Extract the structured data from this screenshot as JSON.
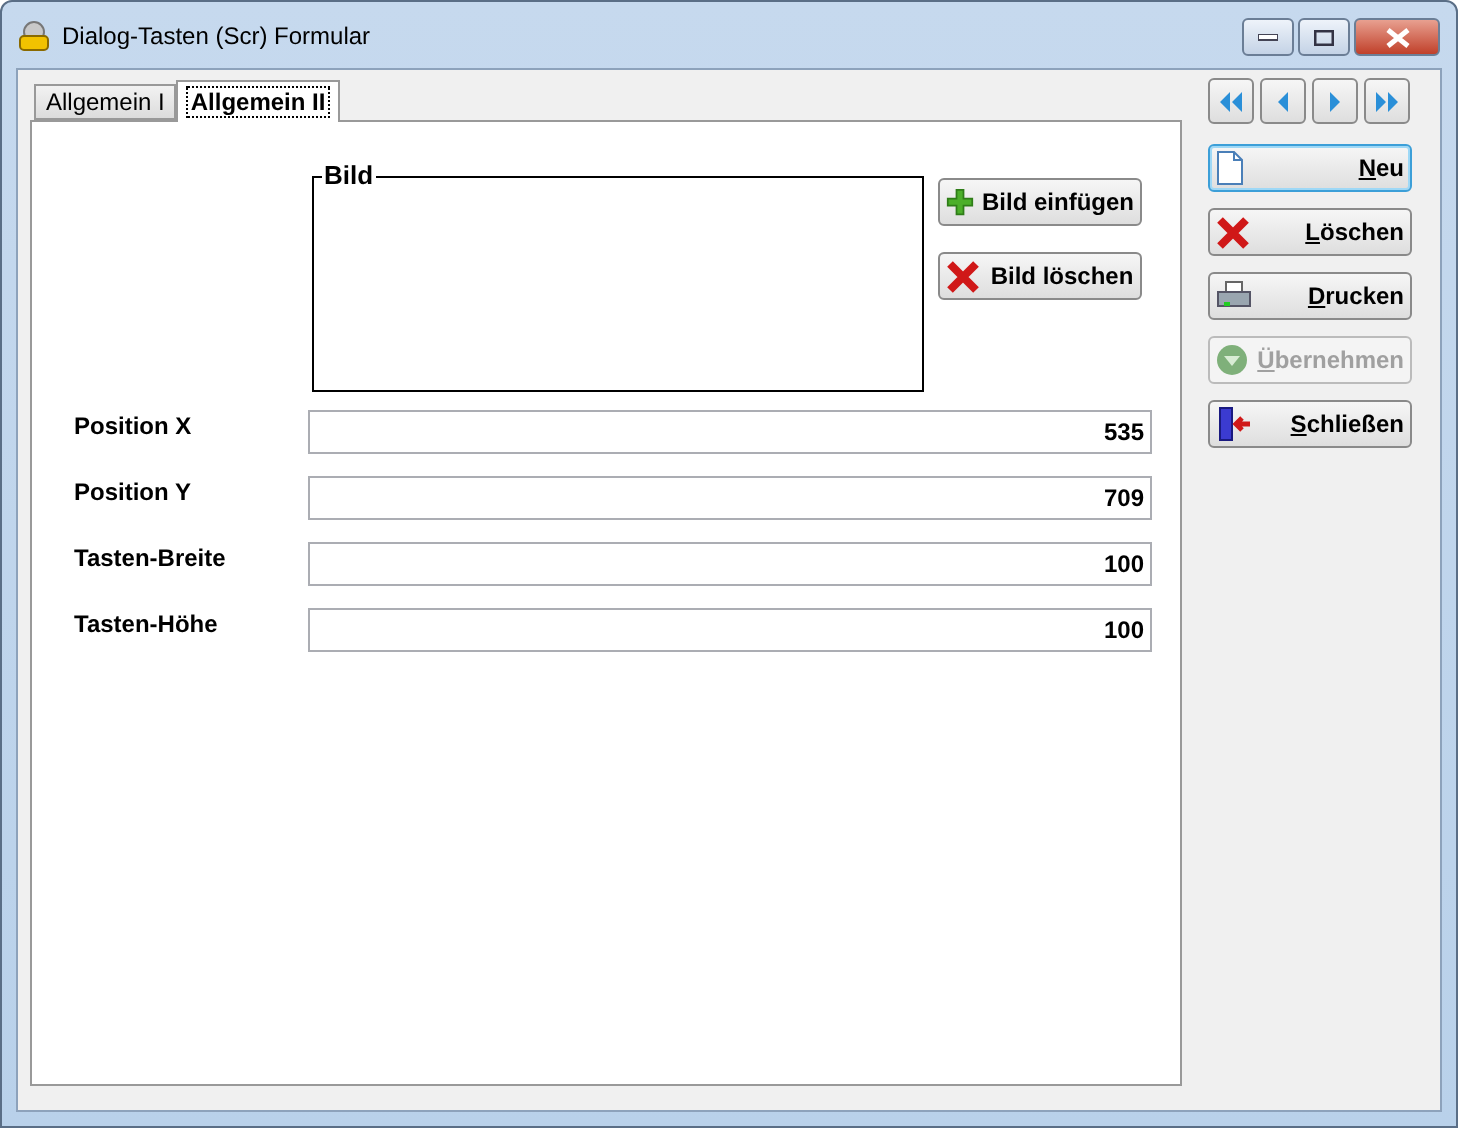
{
  "window": {
    "title": "Dialog-Tasten (Scr) Formular"
  },
  "tabs": [
    {
      "label": "Allgemein I",
      "selected": false
    },
    {
      "label": "Allgemein II",
      "selected": true
    }
  ],
  "image_group": {
    "legend": "Bild"
  },
  "image_buttons": [
    {
      "kind": "add",
      "label": "Bild einfügen"
    },
    {
      "kind": "delete",
      "label": "Bild löschen"
    }
  ],
  "fields": [
    {
      "label": "Position X",
      "value": "535"
    },
    {
      "label": "Position Y",
      "value": "709"
    },
    {
      "label": "Tasten-Breite",
      "value": "100"
    },
    {
      "label": "Tasten-Höhe",
      "value": "100"
    }
  ],
  "navigation": [
    {
      "kind": "first"
    },
    {
      "kind": "previous"
    },
    {
      "kind": "next"
    },
    {
      "kind": "last"
    }
  ],
  "actions": [
    {
      "kind": "new",
      "label": "Neu",
      "focused": true,
      "disabled": false
    },
    {
      "kind": "delete",
      "label": "Löschen",
      "focused": false,
      "disabled": false
    },
    {
      "kind": "print",
      "label": "Drucken",
      "focused": false,
      "disabled": false
    },
    {
      "kind": "apply",
      "label": "Übernehmen",
      "focused": false,
      "disabled": true
    },
    {
      "kind": "close",
      "label": "Schließen",
      "focused": false,
      "disabled": false
    }
  ]
}
